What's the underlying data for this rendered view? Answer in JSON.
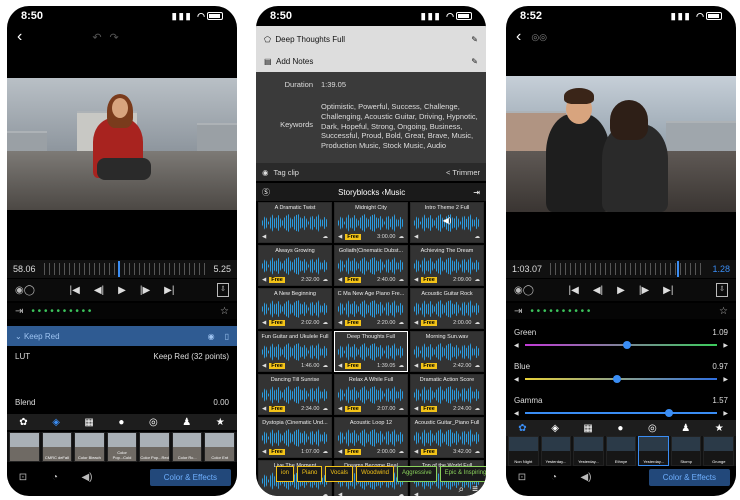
{
  "phone1": {
    "time": "8:50",
    "timeline": {
      "left": "58.06",
      "right": "5.25",
      "playhead_fraction": 0.46
    },
    "layer_name": "Keep Red",
    "lut": {
      "label": "LUT",
      "value": "Keep Red (32 points)"
    },
    "blend": {
      "label": "Blend",
      "value": "0.00"
    },
    "thumbs": [
      "",
      "CMRC deFall",
      "Color Bleach",
      "Color Pop...Cold",
      "Color Pop...Red",
      "Color Rc...",
      "Color Ent"
    ],
    "fx_label": "Color & Effects"
  },
  "phone2": {
    "time": "8:50",
    "clip_title": "Deep Thoughts Full",
    "add_notes": "Add Notes",
    "duration_label": "Duration",
    "duration_value": "1:39.05",
    "keywords_label": "Keywords",
    "keywords_value": "Optimistic, Powerful, Success, Challenge, Challenging, Acoustic Guitar, Driving, Hypnotic, Dark, Hopeful, Strong, Ongoing, Business, Successful, Proud, Bold, Great, Brave, Music, Production Music, Stock Music, Audio",
    "tag_clip": "Tag clip",
    "trimmer": "< Trimmer",
    "header": "Storyblocks ‹Music",
    "tracks": [
      {
        "title": "A Dramatic Twist",
        "free": "",
        "duration": ""
      },
      {
        "title": "Midnight City",
        "free": "Free",
        "duration": "3:00.00"
      },
      {
        "title": "Intro Theme 2 Full",
        "free": "",
        "duration": ""
      },
      {
        "title": "Always Growing",
        "free": "Free",
        "duration": "2:32.00"
      },
      {
        "title": "Goliath(Cinematic Dubst...",
        "free": "Free",
        "duration": "2:40.00"
      },
      {
        "title": "Achieving The Dream",
        "free": "Free",
        "duration": "2:09.00"
      },
      {
        "title": "A New Beginning",
        "free": "Free",
        "duration": "2:02.00"
      },
      {
        "title": "C Ma New Age Piano Fre...",
        "free": "Free",
        "duration": "2:20.00"
      },
      {
        "title": "Acoustic Guitar Rock",
        "free": "Free",
        "duration": "2:00.00"
      },
      {
        "title": "Fun Guitar and Ukulele Full",
        "free": "Free",
        "duration": "1:46.00"
      },
      {
        "title": "Deep Thoughts Full",
        "free": "Free",
        "duration": "1:39.05"
      },
      {
        "title": "Morning Sun.wav",
        "free": "Free",
        "duration": "2:42.00"
      },
      {
        "title": "Dancing Till Sunrise",
        "free": "Free",
        "duration": "2:34.00"
      },
      {
        "title": "Relax A While Full",
        "free": "Free",
        "duration": "2:07.00"
      },
      {
        "title": "Dramatic Action Score",
        "free": "Free",
        "duration": "2:24.00"
      },
      {
        "title": "Dystopia (Cinematic Und...",
        "free": "Free",
        "duration": "1:07.00"
      },
      {
        "title": "Acoustic Loop 12",
        "free": "Free",
        "duration": "2:00.00"
      },
      {
        "title": "Acoustic Guitar_Piano Full",
        "free": "Free",
        "duration": "3:42.00"
      },
      {
        "title": "Live The Moment",
        "free": "",
        "duration": ""
      },
      {
        "title": "Dreams Become Real",
        "free": "",
        "duration": ""
      },
      {
        "title": "Top of the World Full",
        "free": "",
        "duration": ""
      }
    ],
    "moods": [
      "ion",
      "Piano",
      "Vocals",
      "Woodwind",
      "Aggressive",
      "Epic & Inspiring",
      "Hap"
    ]
  },
  "phone3": {
    "time": "8:52",
    "timeline": {
      "left": "1:03.07",
      "right": "1.28",
      "playhead_fraction": 0.82
    },
    "green": {
      "label": "Green",
      "value": "1.09",
      "fraction": 0.53
    },
    "blue": {
      "label": "Blue",
      "value": "0.97",
      "fraction": 0.48
    },
    "gamma": {
      "label": "Gamma",
      "value": "1.57",
      "fraction": 0.75
    },
    "thumbs": [
      "Non Night",
      "Yesterday...",
      "Yesterday...",
      "Ethnye",
      "Yesterday...",
      "Stomp",
      "Grunge"
    ],
    "fx_label": "Color & Effects"
  }
}
